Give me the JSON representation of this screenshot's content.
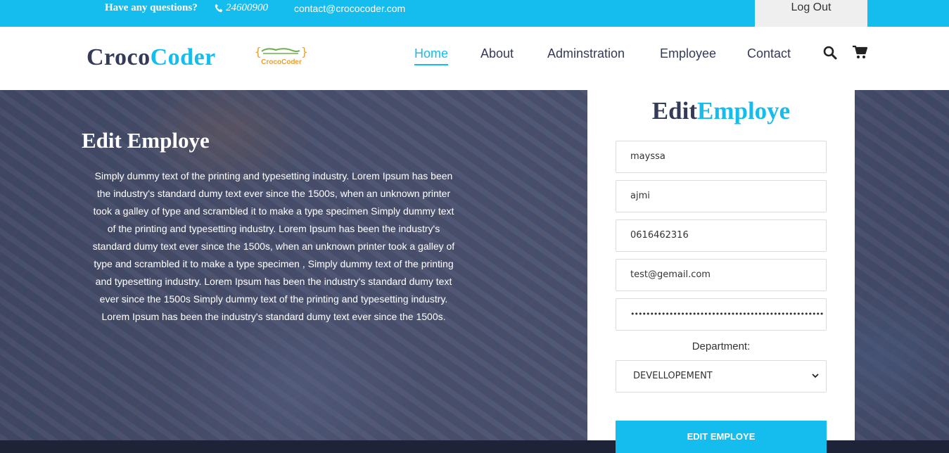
{
  "topbar": {
    "question": "Have any questions?",
    "phone": "24600900",
    "email": "contact@crococoder.com",
    "logout_label": "Log Out"
  },
  "header": {
    "brand_part1": "Croco",
    "brand_part2": "Coder",
    "logo_text": "CrocoCoder",
    "nav": [
      {
        "label": "Home",
        "active": true
      },
      {
        "label": "About",
        "active": false
      },
      {
        "label": "Adminstration",
        "active": false
      },
      {
        "label": "Employee",
        "active": false
      },
      {
        "label": "Contact",
        "active": false
      }
    ],
    "icons": [
      "search-icon",
      "cart-icon"
    ]
  },
  "hero": {
    "title": "Edit Employe",
    "body": "Simply dummy text of the printing and typesetting industry. Lorem Ipsum has been the industry's standard dumy text ever since the 1500s, when an unknown printer took a galley of type and scrambled it to make a type specimen Simply dummy text of the printing and typesetting industry. Lorem Ipsum has been the industry's standard dumy text ever since the 1500s, when an unknown printer took a galley of type and scrambled it to make a type specimen , Simply dummy text of the printing and typesetting industry. Lorem Ipsum has been the industry's standard dumy text ever since the 1500s Simply dummy text of the printing and typesetting industry. Lorem Ipsum has been the industry's standard dumy text ever since the 1500s."
  },
  "form": {
    "title_part1": "Edit",
    "title_part2": "Employe",
    "first_name": "mayssa",
    "last_name": "ajmi",
    "phone": "0616462316",
    "email": "test@gemail.com",
    "password_mask": "••••••••••••••••••••••••••••••••••••••••••••••••••",
    "department_label": "Department:",
    "department_selected": "DEVELLOPEMENT",
    "submit_label": "EDIT EMPLOYE"
  },
  "colors": {
    "accent": "#15bdee",
    "dark": "#343b58",
    "footer": "#1e2338"
  }
}
